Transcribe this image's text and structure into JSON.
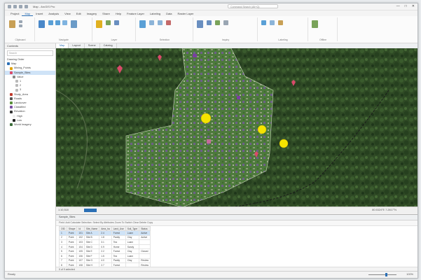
{
  "window": {
    "title": "Map - ArcGIS Pro",
    "search_placeholder": "Command Search (Alt+Q)",
    "controls": [
      "—",
      "□",
      "✕"
    ]
  },
  "ribbon_tabs": [
    "Project",
    "Map",
    "Insert",
    "Analysis",
    "View",
    "Edit",
    "Imagery",
    "Share",
    "Help",
    "Feature Layer",
    "Labeling",
    "Data",
    "Raster Layer"
  ],
  "ribbon_groups": [
    "Clipboard",
    "Navigate",
    "Layer",
    "Selection",
    "Inquiry",
    "Labeling",
    "Offline"
  ],
  "contents": {
    "header": "Contents",
    "search_placeholder": "Search",
    "drawing_order": "Drawing Order",
    "items": [
      {
        "label": "Map",
        "color": "#2a6fb5",
        "indent": 0
      },
      {
        "label": "Mining_Points",
        "color": "#e0a100",
        "indent": 1
      },
      {
        "label": "Sample_Sites",
        "color": "#d94a6a",
        "indent": 1
      },
      {
        "label": "Value",
        "color": "#888888",
        "indent": 2
      },
      {
        "label": "1",
        "color": "#b9b9b9",
        "indent": 3
      },
      {
        "label": "2",
        "color": "#b9b9b9",
        "indent": 3
      },
      {
        "label": "3",
        "color": "#b9b9b9",
        "indent": 3
      },
      {
        "label": "Study_Area",
        "color": "#c0392b",
        "indent": 1
      },
      {
        "label": "Roads",
        "color": "#555555",
        "indent": 1
      },
      {
        "label": "Landcover",
        "color": "#5a8f3a",
        "indent": 1
      },
      {
        "label": "Classified",
        "color": "#7a4fa0",
        "indent": 1
      },
      {
        "label": "Elevation",
        "color": "#333333",
        "indent": 1
      },
      {
        "label": "High",
        "color": "#eeeeee",
        "indent": 2
      },
      {
        "label": "Low",
        "color": "#222222",
        "indent": 2
      },
      {
        "label": "World Imagery",
        "color": "#3c6e3a",
        "indent": 1
      }
    ]
  },
  "map_tabs": [
    "Map",
    "Layout",
    "Scene",
    "Catalog"
  ],
  "map_status": {
    "scale": "1:10,518",
    "coords": "80.5324°E 7.2817°N"
  },
  "attribute_table": {
    "title": "Sample_Sites",
    "toolbar": "Field: Add  Calculate  Selection: Select By Attributes  Zoom To  Switch  Clear  Delete  Copy",
    "columns": [
      "OID",
      "Shape",
      "Id",
      "Site_Name",
      "Area_ha",
      "Land_Use",
      "Soil_Type",
      "Status"
    ],
    "rows": [
      [
        "1",
        "Point",
        "101",
        "Site A",
        "2.4",
        "Forest",
        "Loam",
        "Active"
      ],
      [
        "2",
        "Point",
        "102",
        "Site B",
        "1.8",
        "Paddy",
        "Clay",
        "Active"
      ],
      [
        "3",
        "Point",
        "103",
        "Site C",
        "3.1",
        "Tea",
        "Loam",
        ""
      ],
      [
        "4",
        "Point",
        "104",
        "Site D",
        "0.9",
        "Home",
        "Sandy",
        ""
      ],
      [
        "5",
        "Point",
        "105",
        "Site E",
        "2.2",
        "Forest",
        "Clay",
        "Closed"
      ],
      [
        "6",
        "Point",
        "106",
        "Site F",
        "1.5",
        "Tea",
        "Loam",
        ""
      ],
      [
        "7",
        "Point",
        "107",
        "Site G",
        "4.0",
        "Paddy",
        "Clay",
        "Review"
      ],
      [
        "8",
        "Point",
        "108",
        "Site H",
        "2.7",
        "Forest",
        "",
        "Review"
      ],
      [
        "9",
        "Point",
        "109",
        "Site I",
        "1.1",
        "Home",
        "Sandy",
        ""
      ]
    ],
    "footer": "0 of 9 selected"
  },
  "status_bar": {
    "left": "Ready",
    "right": "100%"
  }
}
